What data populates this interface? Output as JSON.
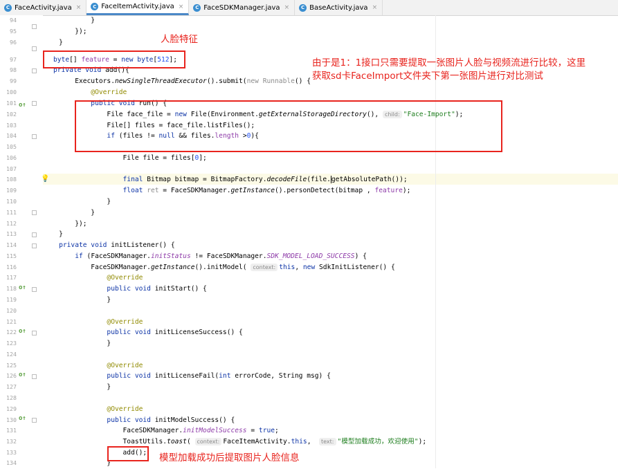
{
  "tabs": [
    {
      "label": "FaceActivity.java",
      "active": false
    },
    {
      "label": "FaceItemActivity.java",
      "active": true
    },
    {
      "label": "FaceSDKManager.java",
      "active": false
    },
    {
      "label": "BaseActivity.java",
      "active": false
    }
  ],
  "tab_badge": "C",
  "tab_close": "×",
  "line_numbers": [
    "94",
    "95",
    "96",
    "97",
    "98",
    "99",
    "100",
    "101",
    "102",
    "103",
    "104",
    "105",
    "106",
    "107",
    "108",
    "109",
    "110",
    "111",
    "112",
    "113",
    "114",
    "115",
    "116",
    "117",
    "118",
    "119",
    "120",
    "121",
    "122",
    "123",
    "124",
    "125",
    "126",
    "127",
    "128",
    "129",
    "130",
    "131",
    "132",
    "133",
    "134"
  ],
  "code": {
    "l94": "            }",
    "l95": "        });",
    "l96": "    }",
    "l97a": "byte",
    "l97b": "[] ",
    "l97c": "feature",
    "l97d": " = ",
    "l97e": "new byte",
    "l97f": "[",
    "l97g": "512",
    "l97h": "];",
    "l98a": "private void ",
    "l98b": "add",
    "l98c": "(){",
    "l99a": "        Executors.",
    "l99b": "newSingleThreadExecutor",
    "l99c": "().submit(",
    "l99d": "new Runnable",
    "l99e": "() {",
    "l100": "            @Override",
    "l101a": "            public void ",
    "l101b": "run",
    "l101c": "() {",
    "l102a": "                File face_file = ",
    "l102b": "new ",
    "l102c": "File(Environment.",
    "l102d": "getExternalStorageDirectory",
    "l102e": "(), ",
    "l102hint": "child:",
    "l102f": "\"Face-Import\"",
    "l102g": ");",
    "l103": "                File[] files = face_file.listFiles();",
    "l104a": "                ",
    "l104b": "if ",
    "l104c": "(files != ",
    "l104d": "null ",
    "l104e": "&& files.",
    "l104f": "length ",
    "l104g": ">",
    "l104h": "0",
    "l104i": "){",
    "l106a": "                    File file = files[",
    "l106b": "0",
    "l106c": "];",
    "l108a": "                    ",
    "l108b": "final ",
    "l108c": "Bitmap bitmap = BitmapFactory.",
    "l108d": "decodeFile",
    "l108e": "(file.",
    "l108f": "getAbsolutePath());",
    "l109a": "                    ",
    "l109b": "float ",
    "l109c": "ret",
    "l109d": " = FaceSDKManager.",
    "l109e": "getInstance",
    "l109f": "().personDetect(bitmap , ",
    "l109g": "feature",
    "l109h": ");",
    "l110": "                }",
    "l111": "            }",
    "l112": "        });",
    "l113": "    }",
    "l114a": "    private void ",
    "l114b": "initListener() {",
    "l115a": "        ",
    "l115b": "if ",
    "l115c": "(FaceSDKManager.",
    "l115d": "initStatus",
    "l115e": " != FaceSDKManager.",
    "l115f": "SDK_MODEL_LOAD_SUCCESS",
    "l115g": ") {",
    "l116a": "            FaceSDKManager.",
    "l116b": "getInstance",
    "l116c": "().initModel( ",
    "l116hint": "context:",
    "l116d": "this",
    "l116e": ", ",
    "l116f": "new ",
    "l116g": "SdkInitListener() {",
    "l117": "                @Override",
    "l118a": "                public void ",
    "l118b": "initStart() {",
    "l119": "                }",
    "l121": "                @Override",
    "l122a": "                public void ",
    "l122b": "initLicenseSuccess() {",
    "l123": "                }",
    "l125": "                @Override",
    "l126a": "                public void ",
    "l126b": "initLicenseFail(",
    "l126c": "int ",
    "l126d": "errorCode, String msg) {",
    "l127": "                }",
    "l129": "                @Override",
    "l130a": "                public void ",
    "l130b": "initModelSuccess() {",
    "l131a": "                    FaceSDKManager.",
    "l131b": "initModelSuccess",
    "l131c": " = ",
    "l131d": "true",
    "l131e": ";",
    "l132a": "                    ToastUtils.",
    "l132b": "toast",
    "l132c": "( ",
    "l132hint": "context:",
    "l132d": "FaceItemActivity.",
    "l132e": "this",
    "l132f": ",  ",
    "l132hint2": "text:",
    "l132g": "\"模型加载成功，欢迎使用\"",
    "l132h": ");",
    "l133": "                    add();",
    "l134": "                }"
  },
  "notes": {
    "feature": "人脸特征",
    "explain": "由于是1：1接口只需要提取一张图片人脸与视频流进行比较，这里获取sd卡FaceImport文件夹下第一张图片进行对比测试",
    "add": "模型加载成功后提取图片人脸信息"
  },
  "colors": {
    "annotation_red": "#e8231d",
    "keyword": "#0c33a6",
    "string": "#1d7d1d",
    "field": "#8d3aa8",
    "tab_accent": "#4a88c7"
  },
  "gutter_icons": {
    "override": "o↑",
    "bulb": "💡"
  }
}
